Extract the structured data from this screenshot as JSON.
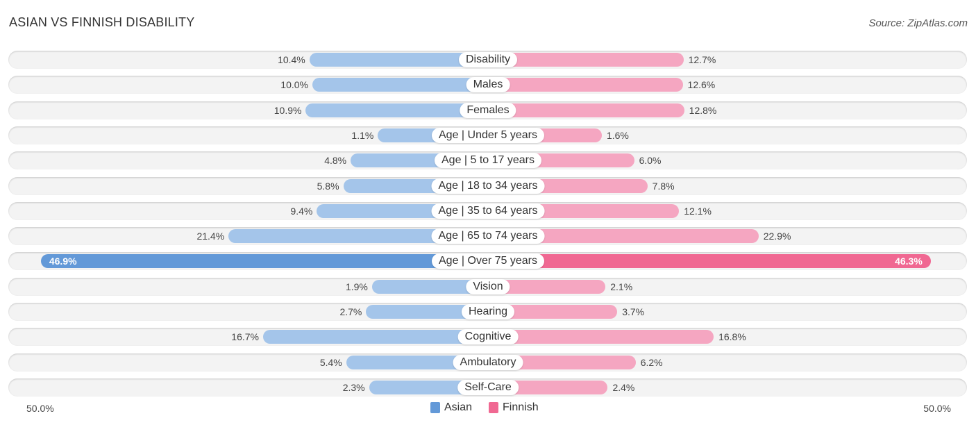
{
  "title": "ASIAN VS FINNISH DISABILITY",
  "source": "Source: ZipAtlas.com",
  "colors": {
    "asian": "#a4c5ea",
    "finnish": "#f5a6c1",
    "asian_strong": "#6399d8",
    "finnish_strong": "#f06892"
  },
  "legend": {
    "asian": "Asian",
    "finnish": "Finnish"
  },
  "axis": {
    "left": "50.0%",
    "right": "50.0%"
  },
  "chart_data": {
    "type": "bar",
    "orientation": "horizontal-diverging",
    "title": "ASIAN VS FINNISH DISABILITY",
    "categories": [
      "Disability",
      "Males",
      "Females",
      "Age | Under 5 years",
      "Age | 5 to 17 years",
      "Age | 18 to 34 years",
      "Age | 35 to 64 years",
      "Age | 65 to 74 years",
      "Age | Over 75 years",
      "Vision",
      "Hearing",
      "Cognitive",
      "Ambulatory",
      "Self-Care"
    ],
    "series": [
      {
        "name": "Asian",
        "values": [
          10.4,
          10.0,
          10.9,
          1.1,
          4.8,
          5.8,
          9.4,
          21.4,
          46.9,
          1.9,
          2.7,
          16.7,
          5.4,
          2.3
        ],
        "labels": [
          "10.4%",
          "10.0%",
          "10.9%",
          "1.1%",
          "4.8%",
          "5.8%",
          "9.4%",
          "21.4%",
          "46.9%",
          "1.9%",
          "2.7%",
          "16.7%",
          "5.4%",
          "2.3%"
        ]
      },
      {
        "name": "Finnish",
        "values": [
          12.7,
          12.6,
          12.8,
          1.6,
          6.0,
          7.8,
          12.1,
          22.9,
          46.3,
          2.1,
          3.7,
          16.8,
          6.2,
          2.4
        ],
        "labels": [
          "12.7%",
          "12.6%",
          "12.8%",
          "1.6%",
          "6.0%",
          "7.8%",
          "12.1%",
          "22.9%",
          "46.3%",
          "2.1%",
          "3.7%",
          "16.8%",
          "6.2%",
          "2.4%"
        ]
      }
    ],
    "xlim": [
      -50,
      50
    ],
    "xtick_labels": [
      "50.0%",
      "50.0%"
    ],
    "legend_position": "bottom-center",
    "highlight_index": 8
  }
}
